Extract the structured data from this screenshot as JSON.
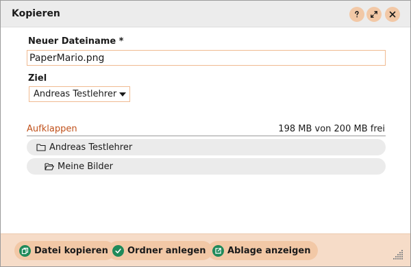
{
  "window": {
    "title": "Kopieren",
    "controls": [
      {
        "name": "help",
        "icon": "question-icon"
      },
      {
        "name": "restore",
        "icon": "restore-icon"
      },
      {
        "name": "close",
        "icon": "close-icon"
      }
    ]
  },
  "form": {
    "filename_label": "Neuer Dateiname *",
    "filename_value": "PaperMario.png",
    "target_label": "Ziel",
    "target_selected": "Andreas Testlehrer"
  },
  "tree": {
    "expand_label": "Aufklappen",
    "storage_info": "198 MB von 200 MB frei",
    "folders": [
      {
        "label": "Andreas Testlehrer",
        "icon": "folder-icon",
        "state": "closed"
      },
      {
        "label": "Meine Bilder",
        "icon": "folder-open-icon",
        "state": "open"
      }
    ]
  },
  "footer": {
    "buttons": [
      {
        "label": "Datei kopieren",
        "icon": "copy-icon"
      },
      {
        "label": "Ordner anlegen",
        "icon": "check-icon"
      },
      {
        "label": "Ablage anzeigen",
        "icon": "external-link-icon"
      }
    ]
  },
  "colors": {
    "accent": "#f2c8a6",
    "footer_bg": "#f6dcc8",
    "link": "#c0501a",
    "icon_fg": "#1f8a5a",
    "input_border": "#f0b990"
  }
}
